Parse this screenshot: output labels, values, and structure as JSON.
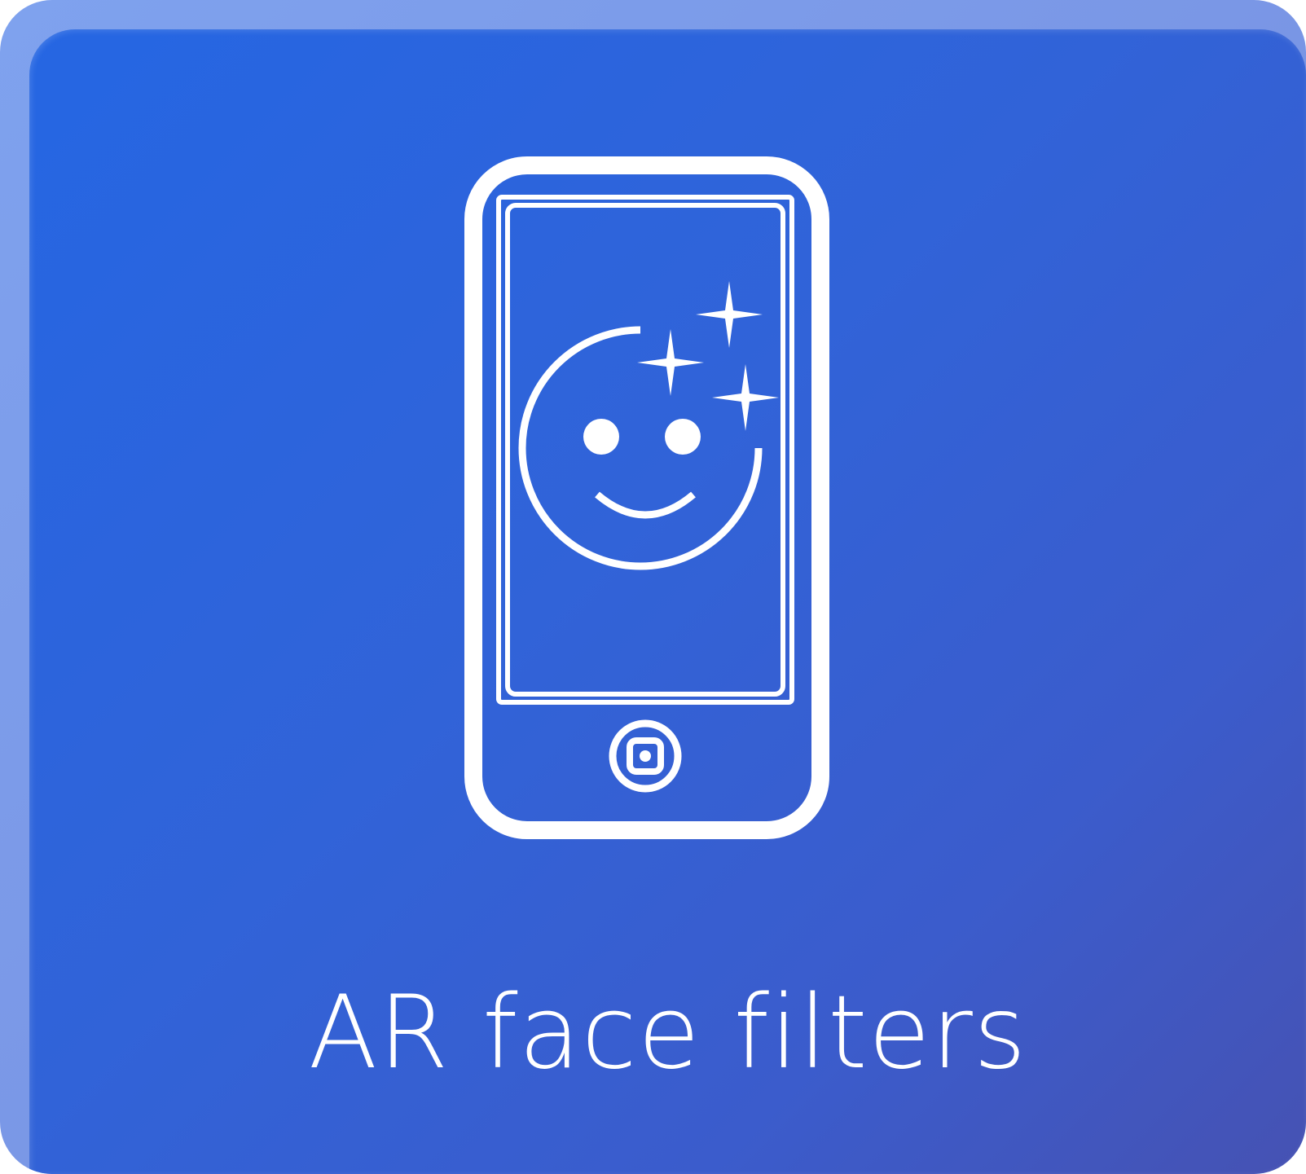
{
  "card": {
    "title": "AR face filters",
    "icon": "phone-smiley-sparkles-icon",
    "colors": {
      "background_start": "#2566e3",
      "background_end": "#4652b3",
      "foreground": "#ffffff"
    }
  }
}
